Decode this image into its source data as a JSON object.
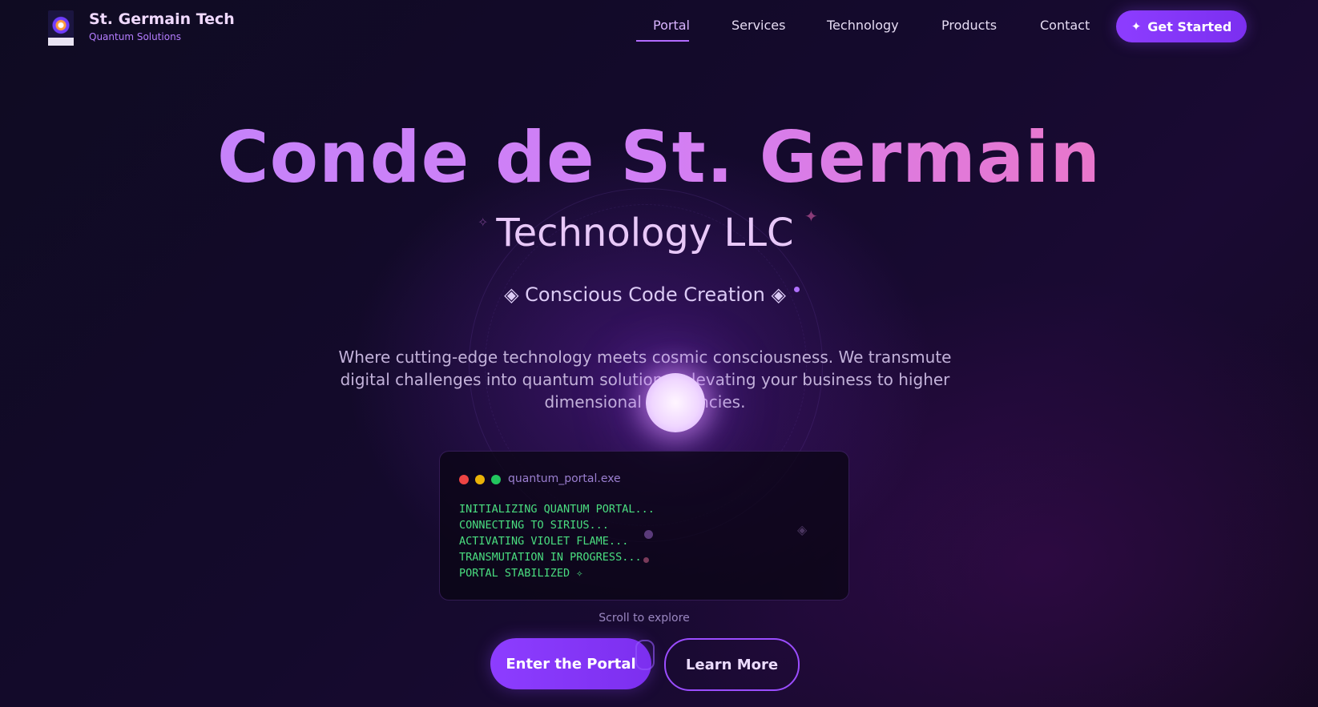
{
  "nav": {
    "brand_name": "St. Germain Tech",
    "brand_sub": "Quantum Solutions",
    "links": [
      "Portal",
      "Services",
      "Technology",
      "Products",
      "Contact"
    ],
    "active_link": "Portal",
    "cta_label": "Get Started",
    "cta_icon": "sparkle-icon"
  },
  "hero": {
    "title": "Conde de St. Germain",
    "subtitle": "Technology LLC",
    "tagline": "◈ Conscious Code Creation ◈",
    "description": "Where cutting-edge technology meets cosmic consciousness. We transmute digital challenges into quantum solutions, elevating your business to higher dimensional frequencies."
  },
  "terminal": {
    "title": "quantum_portal.exe",
    "lines": [
      "INITIALIZING QUANTUM PORTAL...",
      "CONNECTING TO SIRIUS...",
      "ACTIVATING VIOLET FLAME...",
      "TRANSMUTATION IN PROGRESS...",
      "PORTAL STABILIZED ✧"
    ],
    "dot_colors": [
      "#ef4444",
      "#eab308",
      "#22c55e"
    ]
  },
  "scroll_hint": "Scroll to explore",
  "buttons": {
    "primary": "Enter the Portal",
    "secondary": "Learn More"
  },
  "colors": {
    "accent": "#8d3dff",
    "title_gradient_start": "#c084fc",
    "title_gradient_end": "#f472b6",
    "terminal_text": "#4ade80"
  }
}
